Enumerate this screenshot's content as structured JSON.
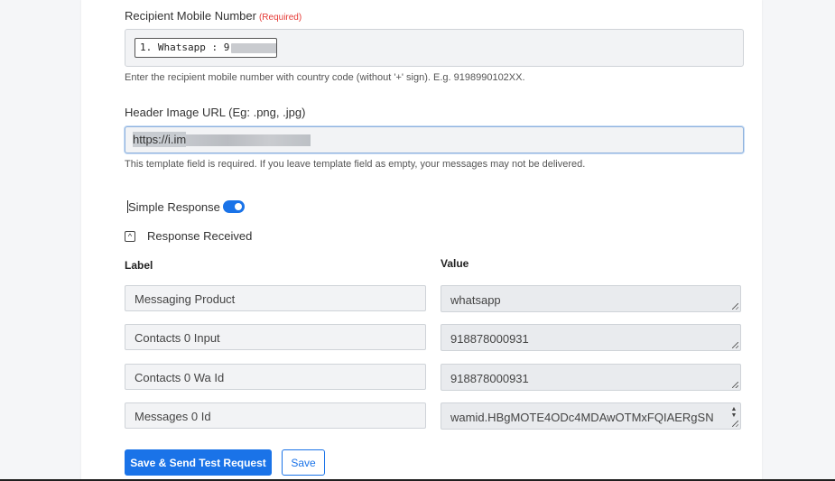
{
  "recipient": {
    "label": "Recipient Mobile Number",
    "required": "(Required)",
    "chip_text": "1. Whatsapp : 9",
    "chip_tail": "9",
    "help": "Enter the recipient mobile number with country code (without '+' sign). E.g. 9198990102XX."
  },
  "header_image": {
    "label": "Header Image URL (Eg: .png, .jpg)",
    "value": "https://i.im",
    "help": "This template field is required. If you leave template field as empty, your messages may not be delivered."
  },
  "simple_response": {
    "label": "Simple Response",
    "enabled": true
  },
  "response_received": {
    "label": "Response Received",
    "collapse_glyph": "^"
  },
  "table": {
    "label_header": "Label",
    "value_header": "Value",
    "rows": [
      {
        "label": "Messaging Product",
        "value": "whatsapp"
      },
      {
        "label": "Contacts 0 Input",
        "value": "918878000931"
      },
      {
        "label": "Contacts 0 Wa Id",
        "value": "918878000931"
      },
      {
        "label": "Messages 0 Id",
        "value": "wamid.HBgMOTE4ODc4MDAwOTMxFQIAERgSN"
      }
    ]
  },
  "actions": {
    "save_send": "Save & Send Test Request",
    "save": "Save"
  },
  "colors": {
    "accent": "#1a73e8",
    "required": "#e53935"
  }
}
